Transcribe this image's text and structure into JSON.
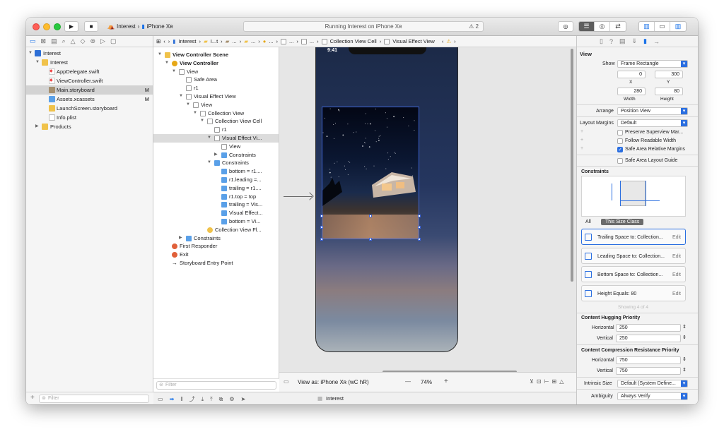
{
  "toolbar": {
    "scheme_project": "Interest",
    "scheme_device": "iPhone Xʀ",
    "status_text": "Running Interest on iPhone Xʀ",
    "warnings": "⚠ 2"
  },
  "navigator": {
    "items": [
      {
        "label": "Interest",
        "marker": ""
      },
      {
        "label": "Interest",
        "marker": ""
      },
      {
        "label": "AppDelegate.swift",
        "marker": ""
      },
      {
        "label": "ViewController.swift",
        "marker": ""
      },
      {
        "label": "Main.storyboard",
        "marker": "M"
      },
      {
        "label": "Assets.xcassets",
        "marker": "M"
      },
      {
        "label": "LaunchScreen.storyboard",
        "marker": ""
      },
      {
        "label": "Info.plist",
        "marker": ""
      },
      {
        "label": "Products",
        "marker": ""
      }
    ],
    "filter_placeholder": "Filter"
  },
  "jumpbar": {
    "items": [
      "Interest",
      "I...t",
      "...",
      "...",
      "...",
      "...",
      "...",
      "Collection View Cell",
      "Visual Effect View"
    ]
  },
  "outline": {
    "items": [
      "View Controller Scene",
      "View Controller",
      "View",
      "Safe Area",
      "r1",
      "Visual Effect View",
      "View",
      "Collection View",
      "Collection View Cell",
      "r1",
      "Visual Effect Vi...",
      "View",
      "Constraints",
      "Constraints",
      "bottom = r1....",
      "r1.leading =...",
      "trailing = r1....",
      "r1.top = top",
      "trailing = Vis...",
      "Visual Effect...",
      "bottom = Vi...",
      "Collection View Fl...",
      "Constraints",
      "First Responder",
      "Exit",
      "Storyboard Entry Point"
    ],
    "filter_placeholder": "Filter"
  },
  "canvas": {
    "status_time": "9:41",
    "view_as": "View as: iPhone Xʀ (wC hR)",
    "zoom": "74%",
    "zoom_minus": "—",
    "zoom_plus": "+"
  },
  "debug": {
    "target": "Interest"
  },
  "inspector": {
    "section_title": "View",
    "show_label": "Show",
    "show_value": "Frame Rectangle",
    "x_value": "0",
    "y_value": "300",
    "x_label": "X",
    "y_label": "Y",
    "width_value": "280",
    "height_value": "80",
    "width_label": "Width",
    "height_label": "Height",
    "arrange_label": "Arrange",
    "arrange_value": "Position View",
    "margins_label": "Layout Margins",
    "margins_value": "Default",
    "check_preserve": "Preserve Superview Mar...",
    "check_readable": "Follow Readable Width",
    "check_safe_margins": "Safe Area Relative Margins",
    "check_safe_guide": "Safe Area Layout Guide",
    "constraints_title": "Constraints",
    "scope_all": "All",
    "scope_size": "This Size Class",
    "constraints": [
      {
        "label": "Trailing Space to:  Collection...",
        "edit": "Edit"
      },
      {
        "label": "Leading Space to:  Collection...",
        "edit": "Edit"
      },
      {
        "label": "Bottom Space to:  Collection...",
        "edit": "Edit"
      },
      {
        "label": "Height Equals:  80",
        "edit": "Edit"
      }
    ],
    "showing": "Showing 4 of 4",
    "hugging_title": "Content Hugging Priority",
    "horizontal_label": "Horizontal",
    "vertical_label": "Vertical",
    "hug_h": "250",
    "hug_v": "250",
    "compression_title": "Content Compression Resistance Priority",
    "comp_h": "750",
    "comp_v": "750",
    "intrinsic_label": "Intrinsic Size",
    "intrinsic_value": "Default (System Define...",
    "ambiguity_label": "Ambiguity",
    "ambiguity_value": "Always Verify"
  }
}
